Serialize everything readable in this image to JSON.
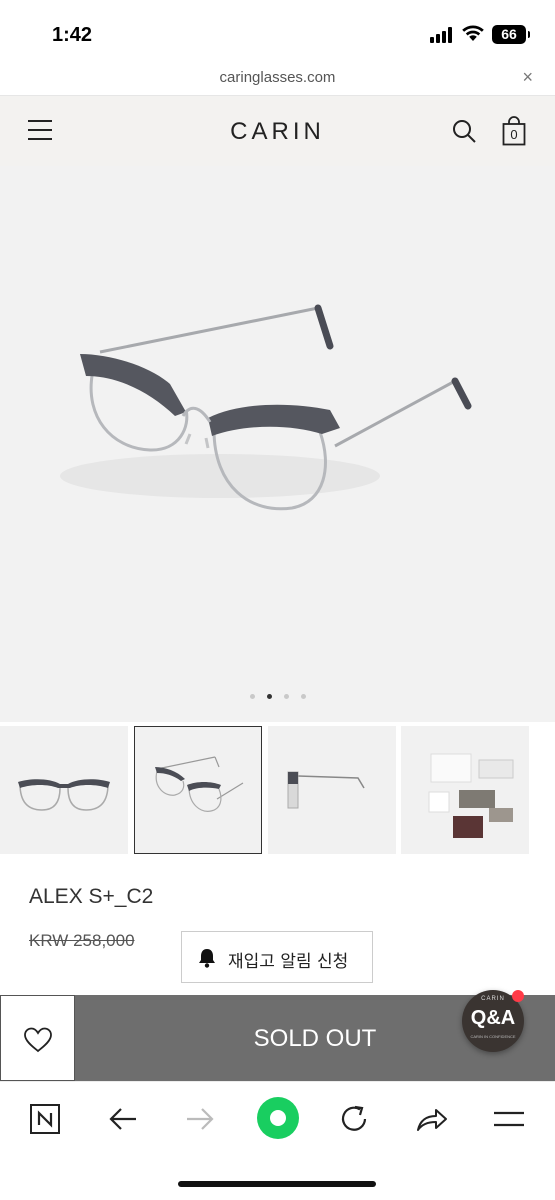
{
  "status_bar": {
    "time": "1:42",
    "battery": "66"
  },
  "browser": {
    "url": "caringlasses.com",
    "close_label": "×"
  },
  "site_header": {
    "brand": "CARIN",
    "cart_count": "0"
  },
  "gallery": {
    "slide_count": 4,
    "active_slide": 2,
    "thumbnail_count": 4,
    "selected_thumbnail": 2
  },
  "product": {
    "name": "ALEX S+_C2",
    "price": "KRW 258,000",
    "restock_label": "재입고 알림 신청",
    "sold_out_label": "SOLD OUT"
  },
  "qa_badge": {
    "brand": "CARIN",
    "label": "Q&A",
    "tagline": "CARIN IN CONFIDENCE"
  },
  "toolbar": {
    "icons": [
      "naver-icon",
      "back-icon",
      "forward-icon",
      "home-icon",
      "refresh-icon",
      "share-icon",
      "menu-icon"
    ]
  },
  "colors": {
    "header_bg": "#f3f2f0",
    "sold_out_bg": "#6e6e6e",
    "qa_bg": "#3a3431",
    "notification": "#ff3b48",
    "home_green": "#19ce60"
  }
}
